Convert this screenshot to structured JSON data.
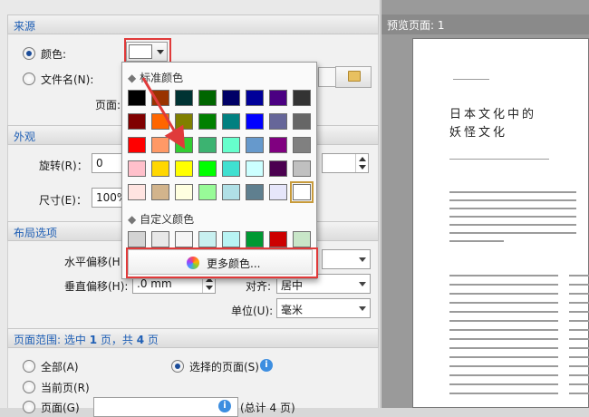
{
  "source": {
    "header": "来源",
    "color_label": "颜色:",
    "file_label": "文件名(N):",
    "page_label": "页面:",
    "browse_icon": "folder-icon"
  },
  "appearance": {
    "header": "外观",
    "rotate_label": "旋转(R)：",
    "rotate_value": "0",
    "size_label": "尺寸(E)：",
    "size_value": "100%"
  },
  "layout": {
    "header": "布局选项",
    "h_offset_label": "水平偏移(H)",
    "v_offset_label": "垂直偏移(H):",
    "v_offset_value": ".0 mm",
    "align_label": "对齐:",
    "align_value": "居中",
    "unit_label": "单位(U):",
    "unit_value": "毫米"
  },
  "page_range": {
    "header_prefix": "页面范围: 选中 ",
    "selected": "1",
    "header_mid": " 页，共 ",
    "total": "4",
    "header_suffix": " 页",
    "all_label": "全部(A)",
    "selected_pages_label": "选择的页面(S)",
    "current_label": "当前页(R)",
    "pages_label": "页面(G)",
    "total_label": "(总计 4 页)"
  },
  "preview": {
    "header": "预览页面: 1",
    "page_title_line1": "日本文化中的",
    "page_title_line2": "妖怪文化"
  },
  "color_popup": {
    "standard_header": "标准颜色",
    "custom_header": "自定义颜色",
    "more_colors": "更多颜色...",
    "standard_rows": [
      [
        "#000000",
        "#993300",
        "#003333",
        "#006600",
        "#000066",
        "#000099",
        "#4b0082",
        "#333333"
      ],
      [
        "#800000",
        "#ff6600",
        "#808000",
        "#008000",
        "#008080",
        "#0000ff",
        "#666699",
        "#666666"
      ],
      [
        "#ff0000",
        "#ff9966",
        "#33cc33",
        "#3cb371",
        "#66ffcc",
        "#6699cc",
        "#800080",
        "#808080"
      ],
      [
        "#ffc0cb",
        "#ffd700",
        "#ffff00",
        "#00ff00",
        "#40e0d0",
        "#ccffff",
        "#4b0050",
        "#c0c0c0"
      ],
      [
        "#ffe4e1",
        "#d2b48c",
        "#ffffe0",
        "#98fb98",
        "#b0e0e6",
        "#5f7f8f",
        "#e6e6fa",
        "#ffffff"
      ]
    ],
    "custom_row": [
      "#d3d3d3",
      "#e8e8e8",
      "#f5f5f5",
      "#c8f0f0",
      "#b8f4f4",
      "#009933",
      "#cc0000",
      "#c8e6c8"
    ]
  }
}
